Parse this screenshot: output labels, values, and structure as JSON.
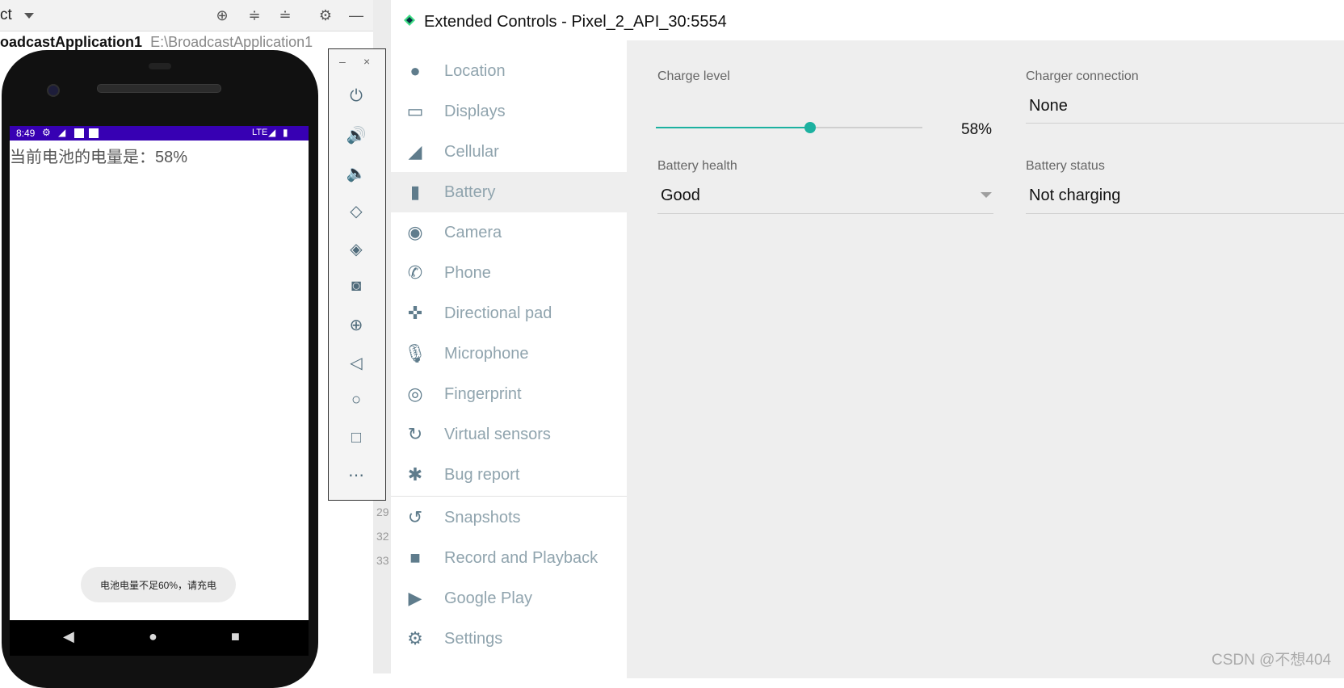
{
  "ide": {
    "project_selector": "ct",
    "project_name": "oadcastApplication1",
    "project_path": "E:\\BroadcastApplication1",
    "gutter_numbers": [
      "29",
      "32",
      "33"
    ],
    "toolbar_icons": [
      "target-icon",
      "expand-all-icon",
      "collapse-all-icon",
      "gear-icon",
      "minimize-icon"
    ]
  },
  "phone": {
    "status_time": "8:49",
    "status_network": "LTE",
    "app_text": "当前电池的电量是：58%",
    "toast": "电池电量不足60%，请充电",
    "nav": {
      "back": "◀",
      "home": "●",
      "recents": "■"
    }
  },
  "emulator_toolbar": {
    "min": "–",
    "close": "×",
    "buttons": [
      "power-icon",
      "volume-up-icon",
      "volume-down-icon",
      "rotate-left-icon",
      "rotate-right-icon",
      "camera-screenshot-icon",
      "zoom-icon",
      "back-icon",
      "home-icon",
      "overview-icon",
      "more-icon"
    ]
  },
  "window": {
    "title": "Extended Controls - Pixel_2_API_30:5554"
  },
  "sidebar": {
    "items": [
      {
        "label": "Location",
        "icon": "location-pin-icon"
      },
      {
        "label": "Displays",
        "icon": "display-icon"
      },
      {
        "label": "Cellular",
        "icon": "cellular-signal-icon"
      },
      {
        "label": "Battery",
        "icon": "battery-icon",
        "active": true
      },
      {
        "label": "Camera",
        "icon": "camera-aperture-icon"
      },
      {
        "label": "Phone",
        "icon": "phone-icon"
      },
      {
        "label": "Directional pad",
        "icon": "dpad-icon"
      },
      {
        "label": "Microphone",
        "icon": "microphone-icon"
      },
      {
        "label": "Fingerprint",
        "icon": "fingerprint-icon"
      },
      {
        "label": "Virtual sensors",
        "icon": "virtual-sensors-icon"
      },
      {
        "label": "Bug report",
        "icon": "bug-icon"
      },
      {
        "label": "Snapshots",
        "icon": "history-icon"
      },
      {
        "label": "Record and Playback",
        "icon": "video-camera-icon"
      },
      {
        "label": "Google Play",
        "icon": "play-store-icon"
      },
      {
        "label": "Settings",
        "icon": "settings-gear-icon"
      }
    ]
  },
  "battery": {
    "charge_level_label": "Charge level",
    "charge_level_value": "58%",
    "charge_level_fraction": 0.58,
    "charger_connection_label": "Charger connection",
    "charger_connection_value": "None",
    "battery_health_label": "Battery health",
    "battery_health_value": "Good",
    "battery_status_label": "Battery status",
    "battery_status_value": "Not charging"
  },
  "watermark": "CSDN @不想404",
  "colors": {
    "accent": "#1cb1a0",
    "phone_status_bar": "#3700b3",
    "nav_label": "#90a4ae",
    "nav_icon": "#5f7c8c"
  }
}
